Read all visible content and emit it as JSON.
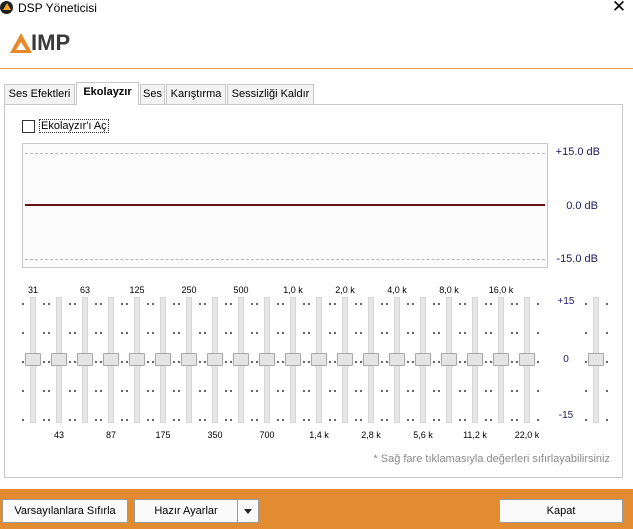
{
  "window": {
    "title": "DSP Yöneticisi",
    "close_glyph": "✕"
  },
  "logo": {
    "text": "IMP"
  },
  "tabs": [
    {
      "label": "Ses Efektleri",
      "active": false
    },
    {
      "label": "Ekolayzır",
      "active": true
    },
    {
      "label": "Ses",
      "active": false
    },
    {
      "label": "Karıştırma",
      "active": false
    },
    {
      "label": "Sessizliği Kaldır",
      "active": false
    }
  ],
  "equalizer": {
    "enable_label": "Ekolayzır'ı Aç",
    "enabled": false,
    "graph_labels": {
      "top": "+15.0 dB",
      "mid": "0.0 dB",
      "bottom": "-15.0 dB"
    },
    "gain_labels": {
      "top": "+15",
      "mid": "0",
      "bottom": "-15"
    },
    "bands": [
      {
        "freq": "31",
        "gain": 0
      },
      {
        "freq": "43",
        "gain": 0
      },
      {
        "freq": "63",
        "gain": 0
      },
      {
        "freq": "87",
        "gain": 0
      },
      {
        "freq": "125",
        "gain": 0
      },
      {
        "freq": "175",
        "gain": 0
      },
      {
        "freq": "250",
        "gain": 0
      },
      {
        "freq": "350",
        "gain": 0
      },
      {
        "freq": "500",
        "gain": 0
      },
      {
        "freq": "700",
        "gain": 0
      },
      {
        "freq": "1,0 k",
        "gain": 0
      },
      {
        "freq": "1,4 k",
        "gain": 0
      },
      {
        "freq": "2,0 k",
        "gain": 0
      },
      {
        "freq": "2,8 k",
        "gain": 0
      },
      {
        "freq": "4,0 k",
        "gain": 0
      },
      {
        "freq": "5,6 k",
        "gain": 0
      },
      {
        "freq": "8,0 k",
        "gain": 0
      },
      {
        "freq": "11,2 k",
        "gain": 0
      },
      {
        "freq": "16,0 k",
        "gain": 0
      },
      {
        "freq": "22,0 k",
        "gain": 0
      }
    ],
    "preamp_gain": 0,
    "hint": "* Sağ fare tıklamasıyla değerleri sıfırlayabilirsiniz"
  },
  "footer": {
    "reset_label": "Varsayılanlara Sıfırla",
    "presets_label": "Hazır Ayarlar",
    "close_label": "Kapat"
  }
}
